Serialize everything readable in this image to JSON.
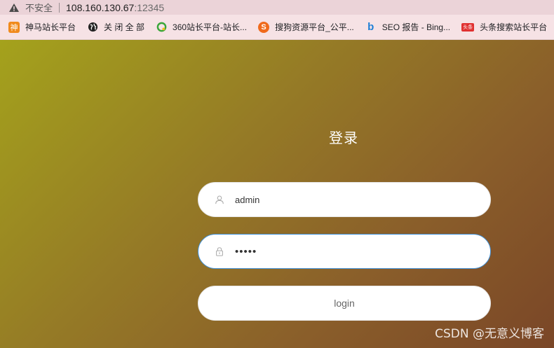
{
  "browser": {
    "insecure_label": "不安全",
    "url_host": "108.160.130.67",
    "url_port": ":12345"
  },
  "bookmarks": [
    {
      "label": "神马站长平台",
      "icon": "shenma-icon",
      "icon_text": "神",
      "color": "#f08a1c"
    },
    {
      "label": "关 闭 全 部",
      "icon": "globe-icon",
      "color": "#222222"
    },
    {
      "label": "360站长平台-站长...",
      "icon": "360-icon",
      "color": "#3aa63a"
    },
    {
      "label": "搜狗资源平台_公平...",
      "icon": "sogou-icon",
      "icon_text": "S",
      "color": "#f06a1c"
    },
    {
      "label": "SEO 报告 - Bing...",
      "icon": "bing-icon",
      "icon_text": "b",
      "color": "#1e7fd6"
    },
    {
      "label": "头条搜索站长平台",
      "icon": "toutiao-icon",
      "icon_text": "头条",
      "color": "#e03030"
    }
  ],
  "login": {
    "title": "登录",
    "username_value": "admin",
    "password_value": "•••••",
    "button_label": "login"
  },
  "watermark": "CSDN @无意义博客"
}
